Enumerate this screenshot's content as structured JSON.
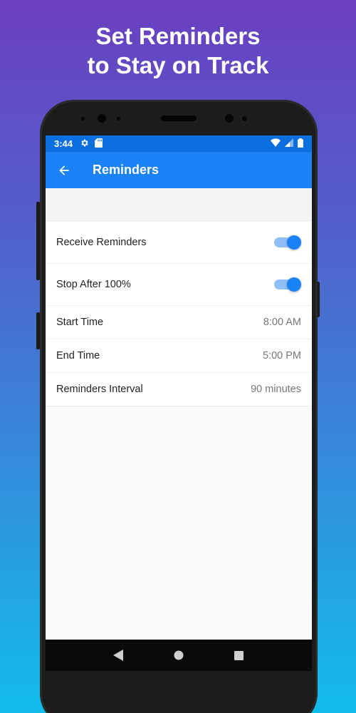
{
  "promo": {
    "line1": "Set Reminders",
    "line2": "to Stay on Track"
  },
  "status_bar": {
    "time": "3:44",
    "icons_left": [
      "gear-icon",
      "sd-card-icon"
    ],
    "icons_right": [
      "wifi-icon",
      "signal-icon",
      "battery-icon"
    ]
  },
  "app_bar": {
    "title": "Reminders",
    "back_icon": "arrow-left-icon"
  },
  "settings": {
    "receive_reminders": {
      "label": "Receive Reminders",
      "enabled": true
    },
    "stop_after": {
      "label": "Stop After 100%",
      "enabled": true
    },
    "start_time": {
      "label": "Start Time",
      "value": "8:00 AM"
    },
    "end_time": {
      "label": "End Time",
      "value": "5:00 PM"
    },
    "interval": {
      "label": "Reminders Interval",
      "value": "90 minutes"
    }
  },
  "nav_bar": {
    "buttons": [
      "back-triangle-icon",
      "home-circle-icon",
      "recents-square-icon"
    ]
  },
  "colors": {
    "accent": "#1b82f5",
    "status_bar": "#0b6fe0",
    "switch_track": "#8ec0f7"
  }
}
